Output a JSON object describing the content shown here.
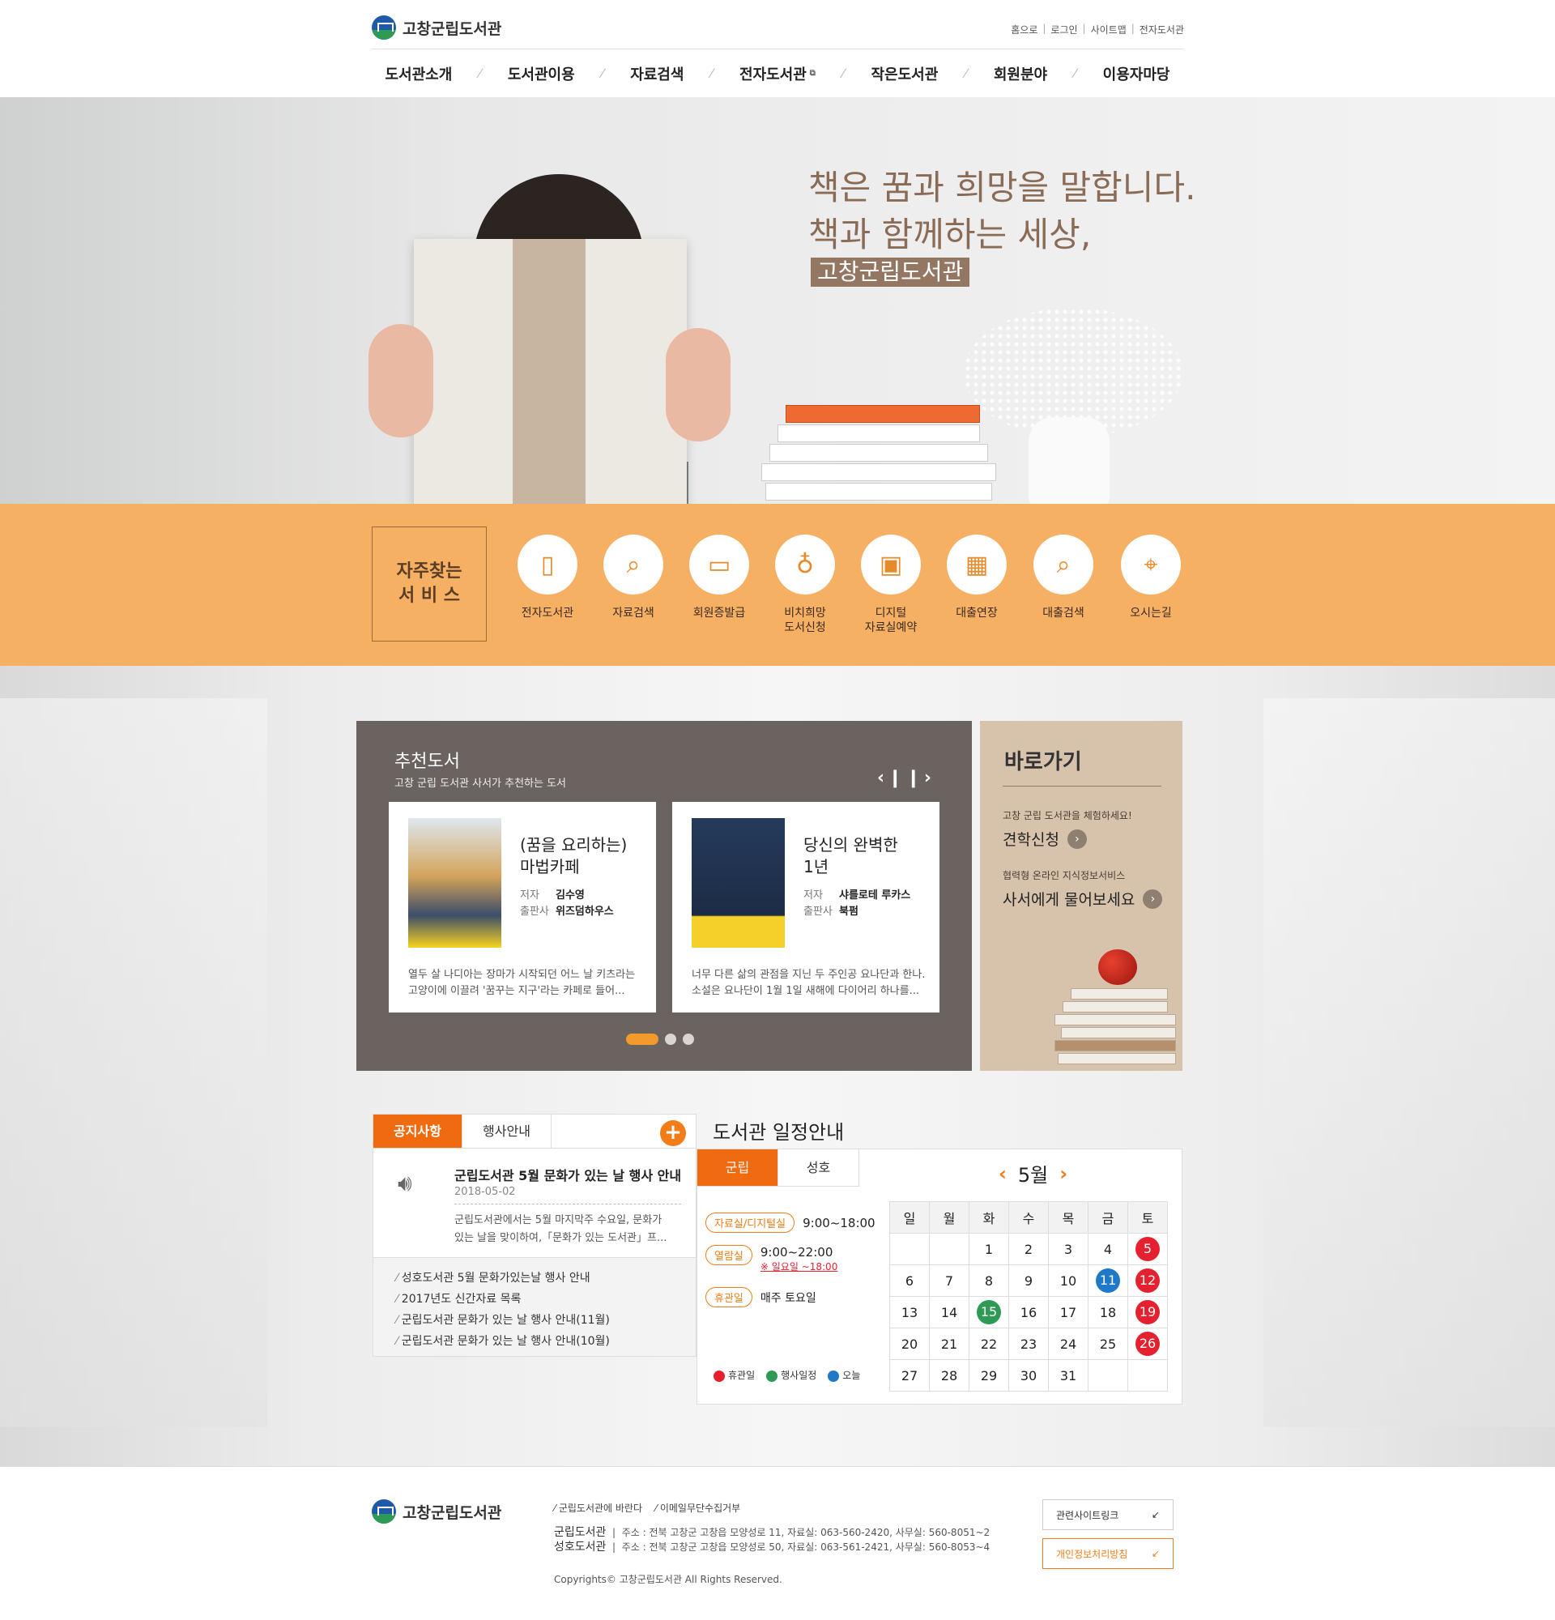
{
  "site": {
    "name": "고창군립도서관"
  },
  "toplinks": [
    "홈으로",
    "로그인",
    "사이트맵",
    "전자도서관"
  ],
  "nav": [
    "도서관소개",
    "도서관이용",
    "자료검색",
    "전자도서관",
    "작은도서관",
    "회원분야",
    "이용자마당"
  ],
  "hero": {
    "line1": "책은 꿈과 희망을 말합니다.",
    "line2": "책과 함께하는 세상,",
    "badge": "고창군립도서관"
  },
  "quick": {
    "title1": "자주찾는",
    "title2": "서 비 스",
    "items": [
      {
        "icon": "tablet-icon",
        "label": "전자도서관",
        "label2": ""
      },
      {
        "icon": "document-search-icon",
        "label": "자료검색",
        "label2": ""
      },
      {
        "icon": "card-icon",
        "label": "회원증발급",
        "label2": ""
      },
      {
        "icon": "lightbulb-icon",
        "label": "비치희망",
        "label2": "도서신청"
      },
      {
        "icon": "monitor-touch-icon",
        "label": "디지털",
        "label2": "자료실예약"
      },
      {
        "icon": "calendar-icon",
        "label": "대출연장",
        "label2": ""
      },
      {
        "icon": "card-search-icon",
        "label": "대출검색",
        "label2": ""
      },
      {
        "icon": "location-icon",
        "label": "오시는길",
        "label2": ""
      }
    ]
  },
  "reco": {
    "title": "추천도서",
    "subtitle": "고창 군립 도서관 사서가 추천하는 도서",
    "books": [
      {
        "title1": "(꿈을 요리하는)",
        "title2": "마법카페",
        "author_label": "저자",
        "author": "김수영",
        "pub_label": "출판사",
        "publisher": "위즈덤하우스",
        "desc1": "열두 살 나디아는 장마가 시작되던 어느 날 키츠라는",
        "desc2": "고양이에 이끌려 '꿈꾸는 지구'라는 카페로 들어..."
      },
      {
        "title1": "당신의 완벽한",
        "title2": "1년",
        "author_label": "저자",
        "author": "샤를로테 루카스",
        "pub_label": "출판사",
        "publisher": "북펌",
        "desc1": "너무 다른 삶의 관점을 지닌 두 주인공 요나단과 한나.",
        "desc2": "소설은 요나단이 1월 1일 새해에 다이어리 하나를..."
      }
    ]
  },
  "shortcut": {
    "title": "바로가기",
    "s1": "고창 군립 도서관을 체험하세요!",
    "l1": "견학신청",
    "s2": "협력형 온라인 지식정보서비스",
    "l2": "사서에게 물어보세요"
  },
  "notice": {
    "tabs": [
      "공지사항",
      "행사안내"
    ],
    "featured_title": "군립도서관 5월 문화가 있는 날 행사 안내",
    "featured_date": "2018-05-02",
    "featured_desc1": "군립도서관에서는 5월 마지막주 수요일, 문화가",
    "featured_desc2": "있는 날을 맞이하여,「문화가 있는 도서관」프...",
    "list": [
      "성호도서관 5월 문화가있는날 행사 안내",
      "2017년도 신간자료 목록",
      "군립도서관 문화가 있는 날 행사 안내(11월)",
      "군립도서관 문화가 있는 날 행사 안내(10월)"
    ]
  },
  "schedule": {
    "title": "도서관 일정안내",
    "tabs": [
      "군립",
      "성호"
    ],
    "month": "5월",
    "rows": [
      {
        "label": "자료실/디지털실",
        "value": "9:00~18:00"
      },
      {
        "label": "열람실",
        "value": "9:00~22:00",
        "note": "※ 일요일 ~18:00"
      },
      {
        "label": "휴관일",
        "value": "매주 토요일"
      }
    ],
    "legend": [
      "휴관일",
      "행사일정",
      "오늘"
    ],
    "weekdays": [
      "일",
      "월",
      "화",
      "수",
      "목",
      "금",
      "토"
    ],
    "weeks": [
      [
        "",
        "",
        "1",
        "2",
        "3",
        "4",
        "5"
      ],
      [
        "6",
        "7",
        "8",
        "9",
        "10",
        "11",
        "12"
      ],
      [
        "13",
        "14",
        "15",
        "16",
        "17",
        "18",
        "19"
      ],
      [
        "20",
        "21",
        "22",
        "23",
        "24",
        "25",
        "26"
      ],
      [
        "27",
        "28",
        "29",
        "30",
        "31",
        "",
        ""
      ]
    ],
    "closed": [
      "5",
      "12",
      "19",
      "26"
    ],
    "event": [
      "15"
    ],
    "today": [
      "11"
    ],
    "colors": {
      "closed": "#e5212f",
      "event": "#2f9a55",
      "today": "#1f78c8"
    }
  },
  "footer": {
    "links": [
      "군립도서관에 바란다",
      "이메일무단수집거부"
    ],
    "addr1_name": "군립도서관",
    "addr1": "주소 : 전북 고창군 고창읍 모양성로 11, 자료실: 063-560-2420, 사무실: 560-8051~2",
    "addr2_name": "성호도서관",
    "addr2": "주소 : 전북 고창군 고창읍 모양성로 50, 자료실: 063-561-2421, 사무실: 560-8053~4",
    "copyright": "Copyrights© 고창군립도서관 All Rights Reserved.",
    "btn1": "관련사이트링크",
    "btn2": "개인정보처리방침"
  }
}
